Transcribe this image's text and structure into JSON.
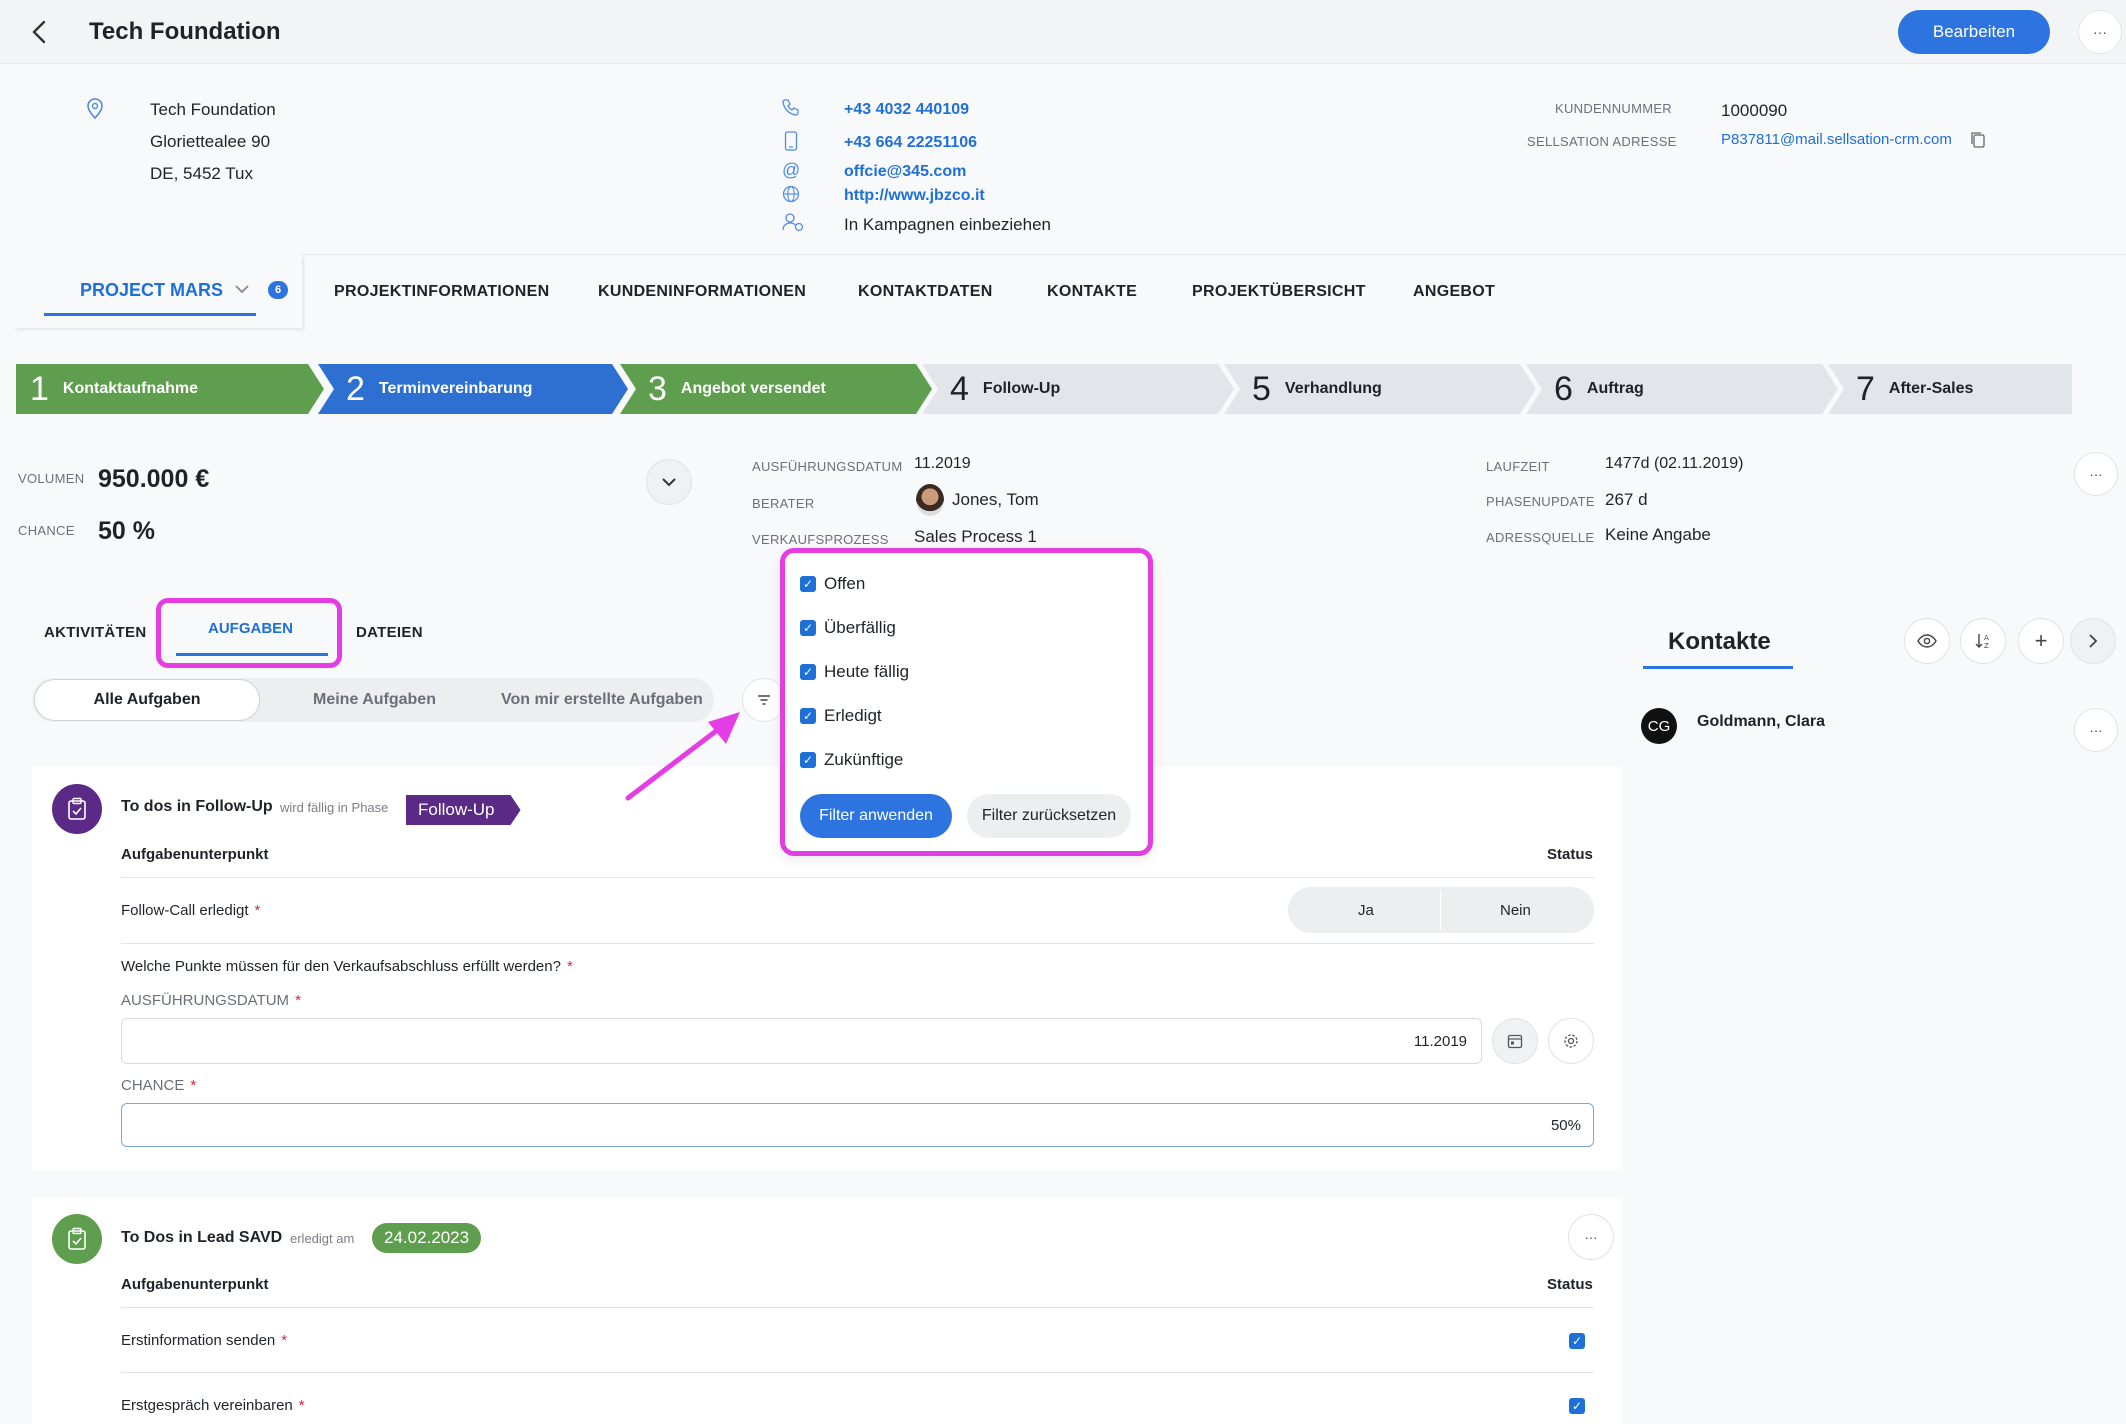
{
  "header": {
    "title": "Tech Foundation",
    "edit_label": "Bearbeiten",
    "more_label": "···"
  },
  "address": {
    "line1": "Tech Foundation",
    "line2": "Gloriettealee 90",
    "line3": "DE, 5452 Tux"
  },
  "contact": {
    "phone": "+43 4032 440109",
    "mobile": "+43 664 22251106",
    "email": "offcie@345.com",
    "web": "http://www.jbzco.it",
    "campaign": "In Kampagnen einbeziehen"
  },
  "customer": {
    "number_label": "KUNDENNUMMER",
    "number": "1000090",
    "address_label": "SELLSATION ADRESSE",
    "address": "P837811@mail.sellsation-crm.com"
  },
  "tabs": {
    "project": "PROJECT MARS",
    "badge": "6",
    "items": [
      "PROJEKTINFORMATIONEN",
      "KUNDENINFORMATIONEN",
      "KONTAKTDATEN",
      "KONTAKTE",
      "PROJEKTÜBERSICHT",
      "ANGEBOT"
    ]
  },
  "stages": [
    {
      "num": "1",
      "label": "Kontaktaufnahme",
      "state": "done",
      "color": "#5f9e4e"
    },
    {
      "num": "2",
      "label": "Terminvereinbarung",
      "state": "done",
      "color": "#2e6fd2"
    },
    {
      "num": "3",
      "label": "Angebot versendet",
      "state": "done",
      "color": "#5f9e4e"
    },
    {
      "num": "4",
      "label": "Follow-Up",
      "state": "todo"
    },
    {
      "num": "5",
      "label": "Verhandlung",
      "state": "todo"
    },
    {
      "num": "6",
      "label": "Auftrag",
      "state": "todo"
    },
    {
      "num": "7",
      "label": "After-Sales",
      "state": "todo"
    }
  ],
  "summary": {
    "volume_label": "VOLUMEN",
    "volume": "950.000 €",
    "chance_label": "CHANCE",
    "chance": "50 %",
    "date_label": "AUSFÜHRUNGSDATUM",
    "date": "11.2019",
    "advisor_label": "BERATER",
    "advisor": "Jones, Tom",
    "process_label": "VERKAUFSPROZESS",
    "process": "Sales Process 1",
    "runtime_label": "LAUFZEIT",
    "runtime": "1477d (02.11.2019)",
    "phase_label": "PHASENUPDATE",
    "phase": "267 d",
    "source_label": "ADRESSQUELLE",
    "source": "Keine Angabe"
  },
  "subtabs": {
    "activities": "AKTIVITÄTEN",
    "tasks": "AUFGABEN",
    "files": "DATEIEN"
  },
  "segments": {
    "all": "Alle Aufgaben",
    "mine": "Meine Aufgaben",
    "created": "Von mir erstellte Aufgaben"
  },
  "filter": {
    "options": [
      "Offen",
      "Überfällig",
      "Heute fällig",
      "Erledigt",
      "Zukünftige"
    ],
    "apply": "Filter anwenden",
    "reset": "Filter zurücksetzen"
  },
  "task1": {
    "title": "To dos in Follow-Up",
    "due_text": "wird fällig in Phase",
    "phase_tag": "Follow-Up",
    "col_item": "Aufgabenunterpunkt",
    "col_status": "Status",
    "row1": "Follow-Call erledigt",
    "yes": "Ja",
    "no": "Nein",
    "question": "Welche Punkte müssen für den Verkaufsabschluss erfüllt werden?",
    "date_label": "AUSFÜHRUNGSDATUM",
    "date_value": "11.2019",
    "chance_label": "CHANCE",
    "chance_value": "50%"
  },
  "task2": {
    "title": "To Dos in Lead SAVD",
    "done_text": "erledigt am",
    "date_tag": "24.02.2023",
    "col_item": "Aufgabenunterpunkt",
    "col_status": "Status",
    "row1": "Erstinformation senden",
    "row2": "Erstgespräch vereinbaren"
  },
  "contacts": {
    "title": "Kontakte",
    "initials": "CG",
    "name": "Goldmann, Clara"
  },
  "colors": {
    "accent": "#2d74e0",
    "highlight": "#e43de4",
    "success": "#5f9e4e",
    "phase": "#5b2a86"
  }
}
